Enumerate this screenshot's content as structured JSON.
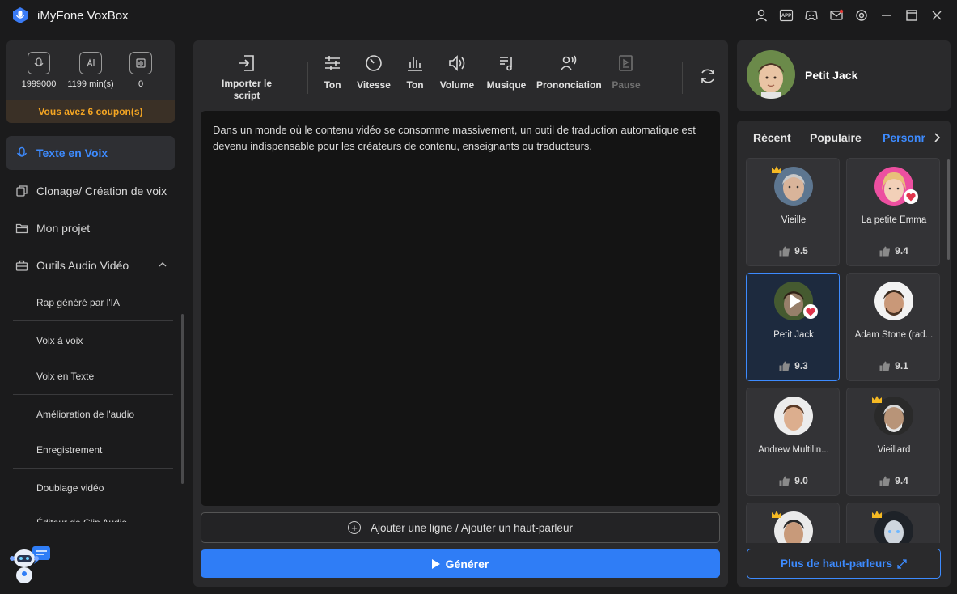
{
  "app": {
    "title": "iMyFone VoxBox"
  },
  "titlebar": {
    "icons": [
      "user-icon",
      "app-icon",
      "discord-icon",
      "mail-icon",
      "settings-icon",
      "minimize-icon",
      "maximize-icon",
      "close-icon"
    ],
    "app_label": "APP"
  },
  "stats": {
    "chars": "1999000",
    "minutes": "1199 min(s)",
    "count": "0",
    "coupon": "Vous avez 6 coupon(s)"
  },
  "nav": {
    "tts": "Texte en Voix",
    "clone": "Clonage/ Création de voix",
    "project": "Mon projet",
    "tools": "Outils Audio Vidéo"
  },
  "subnav": [
    "Rap généré par l'IA",
    "Voix à voix",
    "Voix en Texte",
    "Amélioration de l'audio",
    "Enregistrement",
    "Doublage vidéo",
    "Éditeur de Clip Audio"
  ],
  "toolbar": {
    "import_line1": "Importer le",
    "import_line2": "script",
    "ton1": "Ton",
    "vitesse": "Vitesse",
    "ton2": "Ton",
    "volume": "Volume",
    "musique": "Musique",
    "prononciation": "Prononciation",
    "pause": "Pause"
  },
  "editor": {
    "text": "Dans un monde où le contenu vidéo se consomme massivement, un outil de traduction automatique est devenu indispensable pour les créateurs de contenu, enseignants ou traducteurs."
  },
  "actions": {
    "add_line": "Ajouter une ligne / Ajouter un haut-parleur",
    "generate": "Générer"
  },
  "speaker": {
    "name": "Petit Jack"
  },
  "tabs": {
    "recent": "Récent",
    "popular": "Populaire",
    "personal": "Personr"
  },
  "voices": [
    {
      "name": "Vieille",
      "score": "9.5"
    },
    {
      "name": "La petite Emma",
      "score": "9.4"
    },
    {
      "name": "Petit Jack",
      "score": "9.3"
    },
    {
      "name": "Adam Stone (rad...",
      "score": "9.1"
    },
    {
      "name": "Andrew Multilin...",
      "score": "9.0"
    },
    {
      "name": "Vieillard",
      "score": "9.4"
    },
    {
      "name": "",
      "score": ""
    },
    {
      "name": "",
      "score": ""
    }
  ],
  "more": {
    "label": "Plus de haut-parleurs"
  },
  "colors": {
    "accent": "#3d8bff",
    "coupon": "#f5a623",
    "generate": "#2f7df6"
  }
}
